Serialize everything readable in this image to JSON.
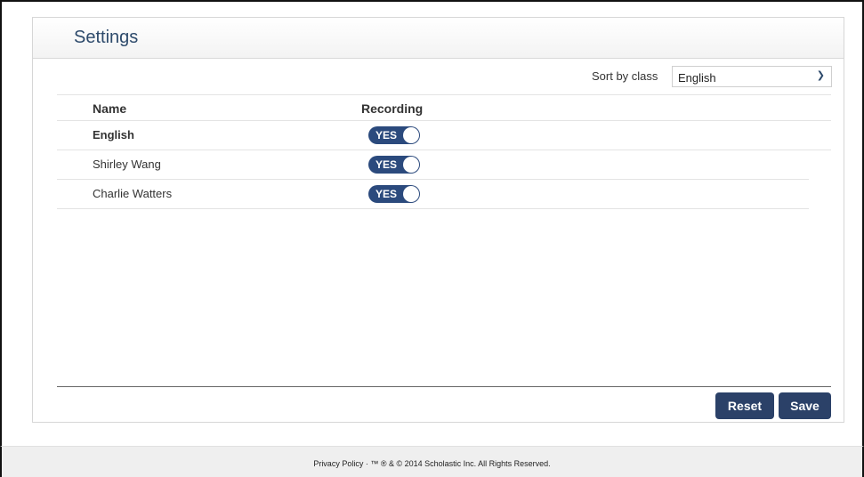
{
  "settings": {
    "title": "Settings",
    "sort_label": "Sort by class",
    "sort_value": "English",
    "columns": {
      "name": "Name",
      "recording": "Recording"
    },
    "rows": [
      {
        "name": "English",
        "recording": "YES"
      },
      {
        "name": "Shirley Wang",
        "recording": "YES"
      },
      {
        "name": "Charlie Watters",
        "recording": "YES"
      }
    ],
    "buttons": {
      "reset": "Reset",
      "save": "Save"
    }
  },
  "footer": {
    "privacy": "Privacy Policy",
    "copyright": " · ™ ® & © 2014 Scholastic Inc. All Rights Reserved."
  },
  "colors": {
    "toggle": "#2b4a7d",
    "button": "#2b4168",
    "title": "#2d4a6b"
  }
}
